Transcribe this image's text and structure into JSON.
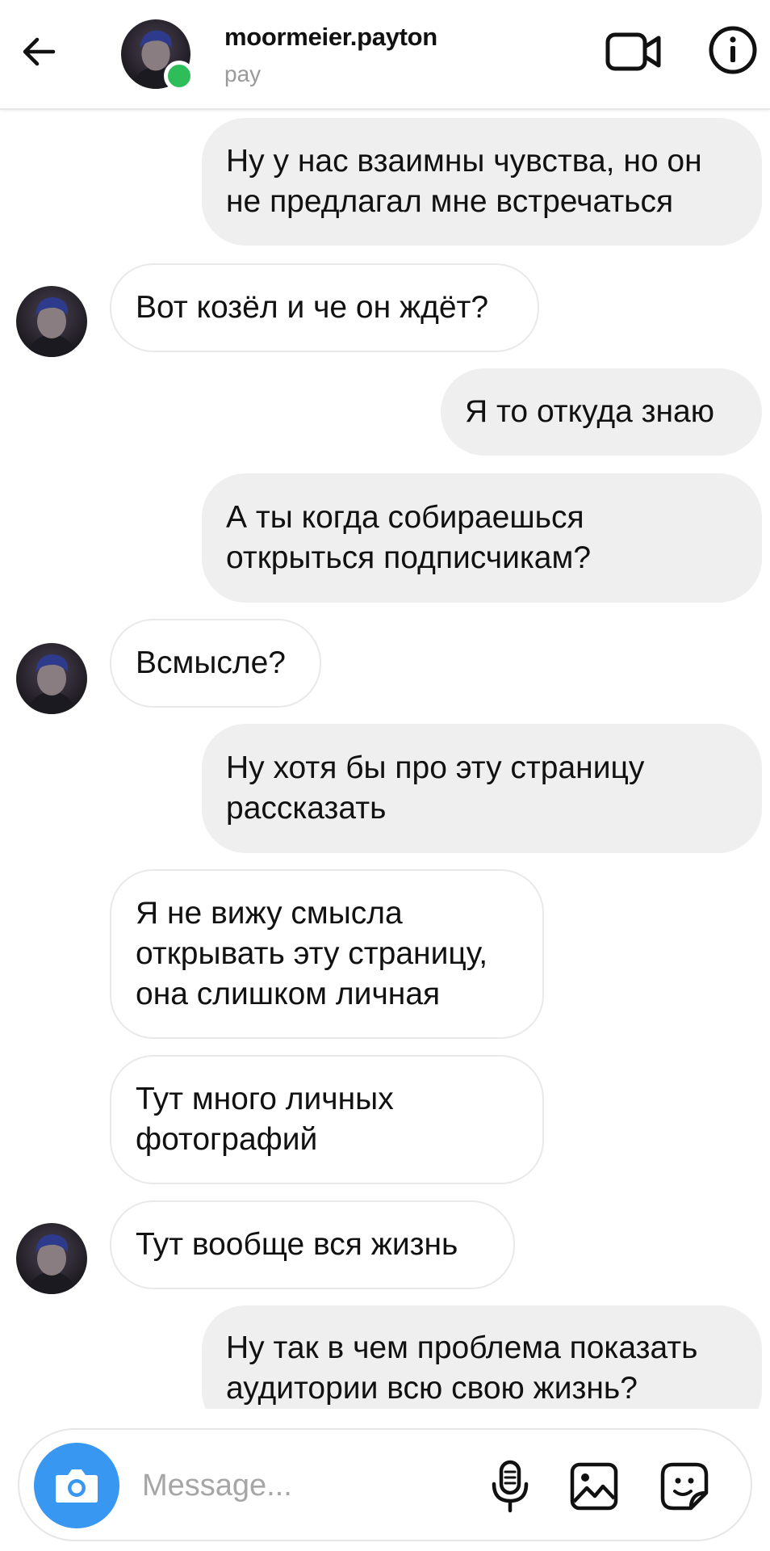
{
  "header": {
    "username": "moormeier.payton",
    "subtitle": "pay",
    "online_color": "#2ebd59"
  },
  "icons": {
    "back": "arrow-left-icon",
    "video": "video-call-icon",
    "info": "info-icon",
    "camera": "camera-icon",
    "mic": "microphone-icon",
    "gallery": "gallery-icon",
    "sticker": "sticker-icon"
  },
  "messages": [
    {
      "from": "me",
      "text": "Ну у нас взаимны чувства, но он\nне предлагал мне встречаться"
    },
    {
      "from": "them",
      "text": "Вот козёл и че он ждёт?"
    },
    {
      "from": "me",
      "text": "Я то откуда знаю"
    },
    {
      "from": "me",
      "text": "А ты когда собираешься\nоткрыться подписчикам?"
    },
    {
      "from": "them",
      "text": "Всмысле?"
    },
    {
      "from": "me",
      "text": "Ну хотя бы про эту страницу\nрассказать"
    },
    {
      "from": "them",
      "text": "Я не вижу смысла\nоткрывать эту страницу,\nона слишком личная"
    },
    {
      "from": "them",
      "text": "Тут много личных\nфотографий"
    },
    {
      "from": "them",
      "text": "Тут вообще вся жизнь"
    },
    {
      "from": "me",
      "text": "Ну так в чем проблема показать\nаудитории всю свою жизнь?"
    }
  ],
  "composer": {
    "placeholder": "Message...",
    "accent": "#3897f0"
  }
}
